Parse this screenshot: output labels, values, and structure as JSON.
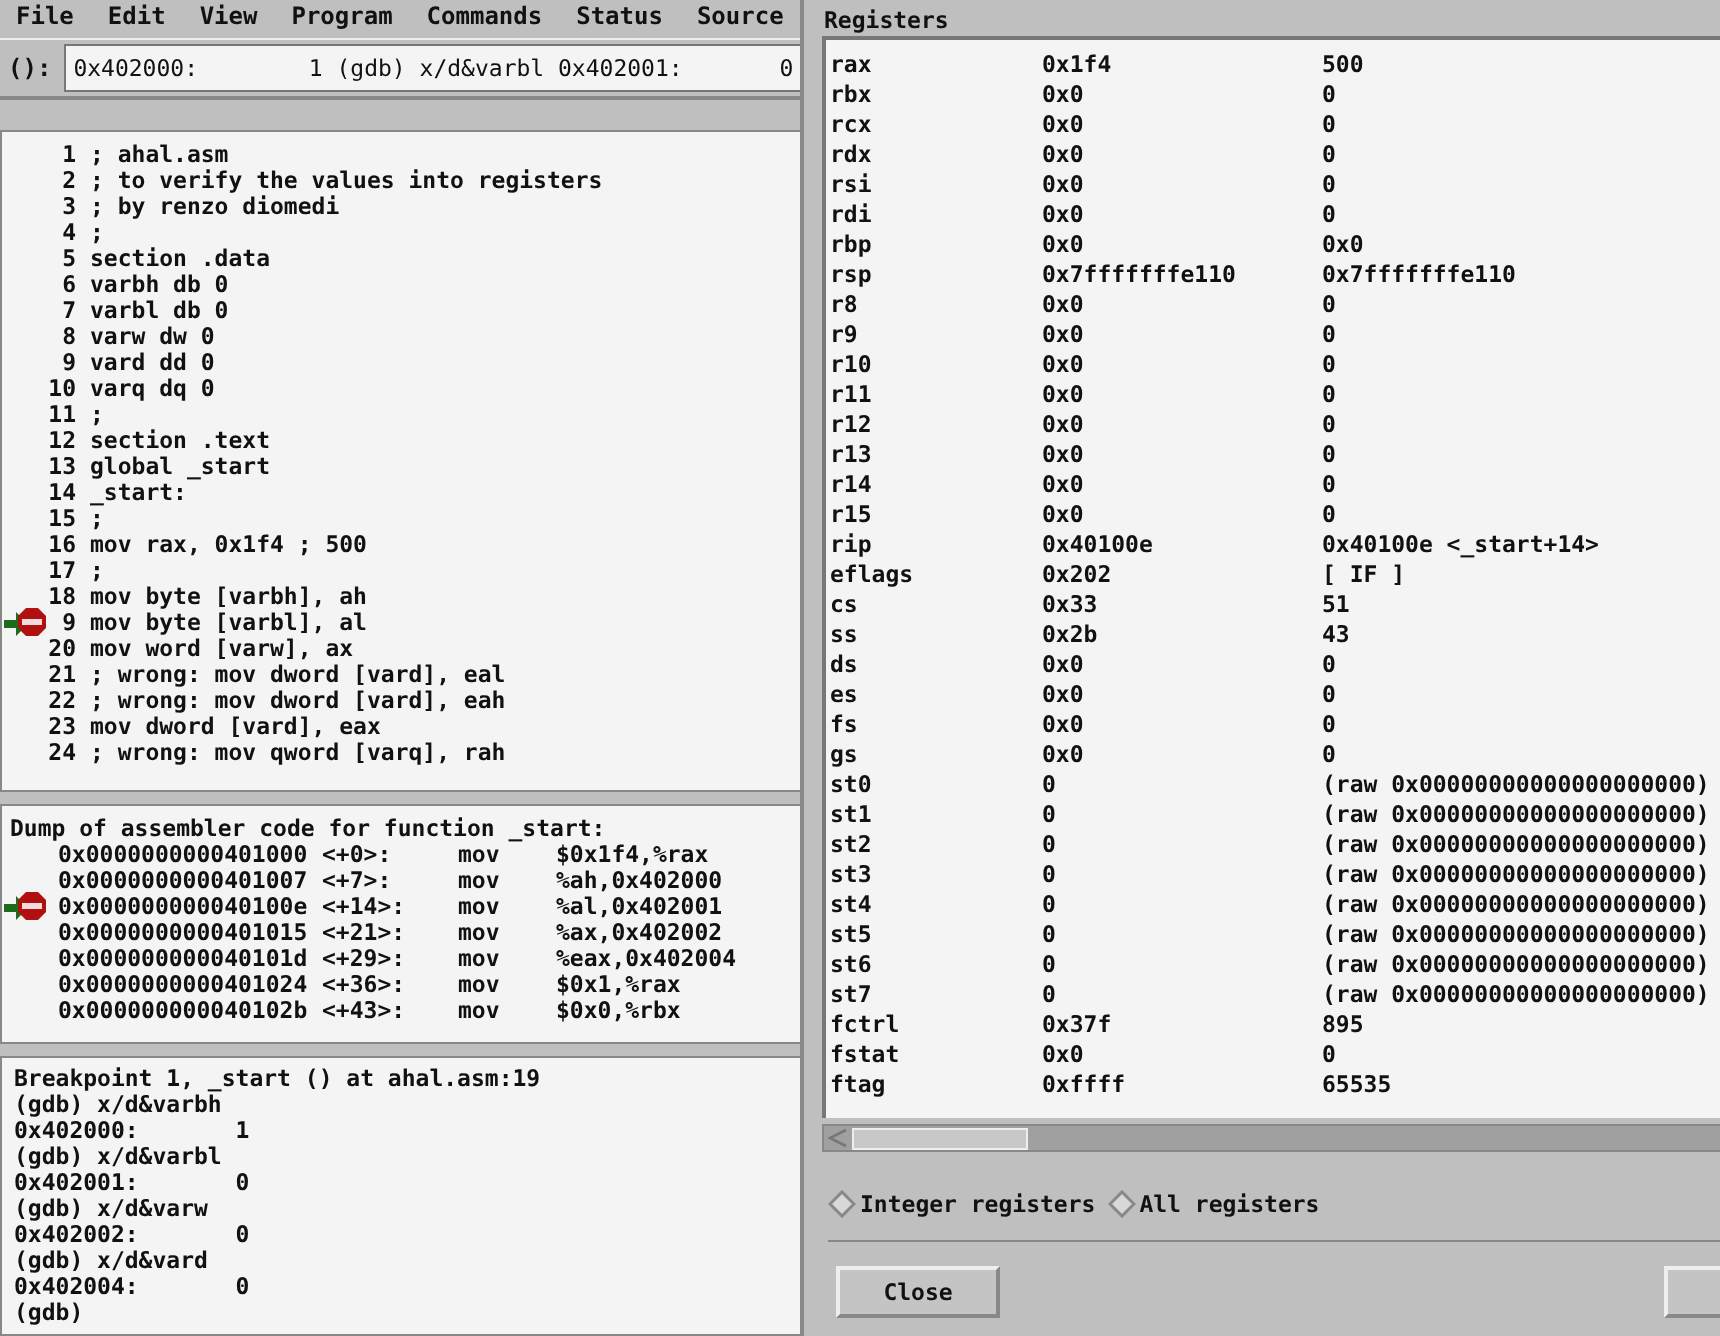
{
  "menu": [
    "File",
    "Edit",
    "View",
    "Program",
    "Commands",
    "Status",
    "Source"
  ],
  "argument": {
    "label": "():",
    "value": "0x402000:        1 (gdb) x/d&varbl 0x402001:       0"
  },
  "source": {
    "lines": [
      {
        "number": "1",
        "text": "; ahal.asm",
        "breakpoint": false,
        "current": false
      },
      {
        "number": "2",
        "text": "; to verify the values into registers",
        "breakpoint": false,
        "current": false
      },
      {
        "number": "3",
        "text": "; by renzo diomedi",
        "breakpoint": false,
        "current": false
      },
      {
        "number": "4",
        "text": ";",
        "breakpoint": false,
        "current": false
      },
      {
        "number": "5",
        "text": "section .data",
        "breakpoint": false,
        "current": false
      },
      {
        "number": "6",
        "text": "varbh db 0",
        "breakpoint": false,
        "current": false
      },
      {
        "number": "7",
        "text": "varbl db 0",
        "breakpoint": false,
        "current": false
      },
      {
        "number": "8",
        "text": "varw dw 0",
        "breakpoint": false,
        "current": false
      },
      {
        "number": "9",
        "text": "vard dd 0",
        "breakpoint": false,
        "current": false
      },
      {
        "number": "10",
        "text": "varq dq 0",
        "breakpoint": false,
        "current": false
      },
      {
        "number": "11",
        "text": ";",
        "breakpoint": false,
        "current": false
      },
      {
        "number": "12",
        "text": "section .text",
        "breakpoint": false,
        "current": false
      },
      {
        "number": "13",
        "text": "global _start",
        "breakpoint": false,
        "current": false
      },
      {
        "number": "14",
        "text": "_start:",
        "breakpoint": false,
        "current": false
      },
      {
        "number": "15",
        "text": ";",
        "breakpoint": false,
        "current": false
      },
      {
        "number": "16",
        "text": "mov rax, 0x1f4 ; 500",
        "breakpoint": false,
        "current": false
      },
      {
        "number": "17",
        "text": ";",
        "breakpoint": false,
        "current": false
      },
      {
        "number": "18",
        "text": "mov byte [varbh], ah",
        "breakpoint": false,
        "current": false
      },
      {
        "number": "9",
        "text": "mov byte [varbl], al",
        "breakpoint": true,
        "current": true
      },
      {
        "number": "20",
        "text": "mov word [varw], ax",
        "breakpoint": false,
        "current": false
      },
      {
        "number": "21",
        "text": "; wrong: mov dword [vard], eal",
        "breakpoint": false,
        "current": false
      },
      {
        "number": "22",
        "text": "; wrong: mov dword [vard], eah",
        "breakpoint": false,
        "current": false
      },
      {
        "number": "23",
        "text": "mov dword [vard], eax",
        "breakpoint": false,
        "current": false
      },
      {
        "number": "24",
        "text": "; wrong: mov qword [varq], rah",
        "breakpoint": false,
        "current": false
      }
    ]
  },
  "disassembly": {
    "header": "Dump of assembler code for function _start:",
    "rows": [
      {
        "address": "0x0000000000401000",
        "offset": "<+0>:",
        "op": "mov",
        "args": "$0x1f4,%rax",
        "breakpoint": false,
        "current": false
      },
      {
        "address": "0x0000000000401007",
        "offset": "<+7>:",
        "op": "mov",
        "args": "%ah,0x402000",
        "breakpoint": false,
        "current": false
      },
      {
        "address": "0x000000000040100e",
        "offset": "<+14>:",
        "op": "mov",
        "args": "%al,0x402001",
        "breakpoint": true,
        "current": true
      },
      {
        "address": "0x0000000000401015",
        "offset": "<+21>:",
        "op": "mov",
        "args": "%ax,0x402002",
        "breakpoint": false,
        "current": false
      },
      {
        "address": "0x000000000040101d",
        "offset": "<+29>:",
        "op": "mov",
        "args": "%eax,0x402004",
        "breakpoint": false,
        "current": false
      },
      {
        "address": "0x0000000000401024",
        "offset": "<+36>:",
        "op": "mov",
        "args": "$0x1,%rax",
        "breakpoint": false,
        "current": false
      },
      {
        "address": "0x000000000040102b",
        "offset": "<+43>:",
        "op": "mov",
        "args": "$0x0,%rbx",
        "breakpoint": false,
        "current": false
      }
    ]
  },
  "console": [
    "Breakpoint 1, _start () at ahal.asm:19",
    "(gdb) x/d&varbh",
    "0x402000:       1",
    "(gdb) x/d&varbl",
    "0x402001:       0",
    "(gdb) x/d&varw",
    "0x402002:       0",
    "(gdb) x/d&vard",
    "0x402004:       0",
    "(gdb)"
  ],
  "registers_dialog": {
    "title": "Registers",
    "rows": [
      {
        "name": "rax",
        "raw": "0x1f4",
        "natural": "500"
      },
      {
        "name": "rbx",
        "raw": "0x0",
        "natural": "0"
      },
      {
        "name": "rcx",
        "raw": "0x0",
        "natural": "0"
      },
      {
        "name": "rdx",
        "raw": "0x0",
        "natural": "0"
      },
      {
        "name": "rsi",
        "raw": "0x0",
        "natural": "0"
      },
      {
        "name": "rdi",
        "raw": "0x0",
        "natural": "0"
      },
      {
        "name": "rbp",
        "raw": "0x0",
        "natural": "0x0"
      },
      {
        "name": "rsp",
        "raw": "0x7fffffffe110",
        "natural": "0x7fffffffe110"
      },
      {
        "name": "r8",
        "raw": "0x0",
        "natural": "0"
      },
      {
        "name": "r9",
        "raw": "0x0",
        "natural": "0"
      },
      {
        "name": "r10",
        "raw": "0x0",
        "natural": "0"
      },
      {
        "name": "r11",
        "raw": "0x0",
        "natural": "0"
      },
      {
        "name": "r12",
        "raw": "0x0",
        "natural": "0"
      },
      {
        "name": "r13",
        "raw": "0x0",
        "natural": "0"
      },
      {
        "name": "r14",
        "raw": "0x0",
        "natural": "0"
      },
      {
        "name": "r15",
        "raw": "0x0",
        "natural": "0"
      },
      {
        "name": "rip",
        "raw": "0x40100e",
        "natural": "0x40100e <_start+14>"
      },
      {
        "name": "eflags",
        "raw": "0x202",
        "natural": "[ IF ]"
      },
      {
        "name": "cs",
        "raw": "0x33",
        "natural": "51"
      },
      {
        "name": "ss",
        "raw": "0x2b",
        "natural": "43"
      },
      {
        "name": "ds",
        "raw": "0x0",
        "natural": "0"
      },
      {
        "name": "es",
        "raw": "0x0",
        "natural": "0"
      },
      {
        "name": "fs",
        "raw": "0x0",
        "natural": "0"
      },
      {
        "name": "gs",
        "raw": "0x0",
        "natural": "0"
      },
      {
        "name": "st0",
        "raw": "0",
        "natural": "(raw 0x00000000000000000000)"
      },
      {
        "name": "st1",
        "raw": "0",
        "natural": "(raw 0x00000000000000000000)"
      },
      {
        "name": "st2",
        "raw": "0",
        "natural": "(raw 0x00000000000000000000)"
      },
      {
        "name": "st3",
        "raw": "0",
        "natural": "(raw 0x00000000000000000000)"
      },
      {
        "name": "st4",
        "raw": "0",
        "natural": "(raw 0x00000000000000000000)"
      },
      {
        "name": "st5",
        "raw": "0",
        "natural": "(raw 0x00000000000000000000)"
      },
      {
        "name": "st6",
        "raw": "0",
        "natural": "(raw 0x00000000000000000000)"
      },
      {
        "name": "st7",
        "raw": "0",
        "natural": "(raw 0x00000000000000000000)"
      },
      {
        "name": "fctrl",
        "raw": "0x37f",
        "natural": "895"
      },
      {
        "name": "fstat",
        "raw": "0x0",
        "natural": "0"
      },
      {
        "name": "ftag",
        "raw": "0xffff",
        "natural": "65535"
      }
    ],
    "options": [
      {
        "label": "Integer registers",
        "selected": false
      },
      {
        "label": "All registers",
        "selected": false
      }
    ],
    "buttons": [
      "Close"
    ]
  }
}
